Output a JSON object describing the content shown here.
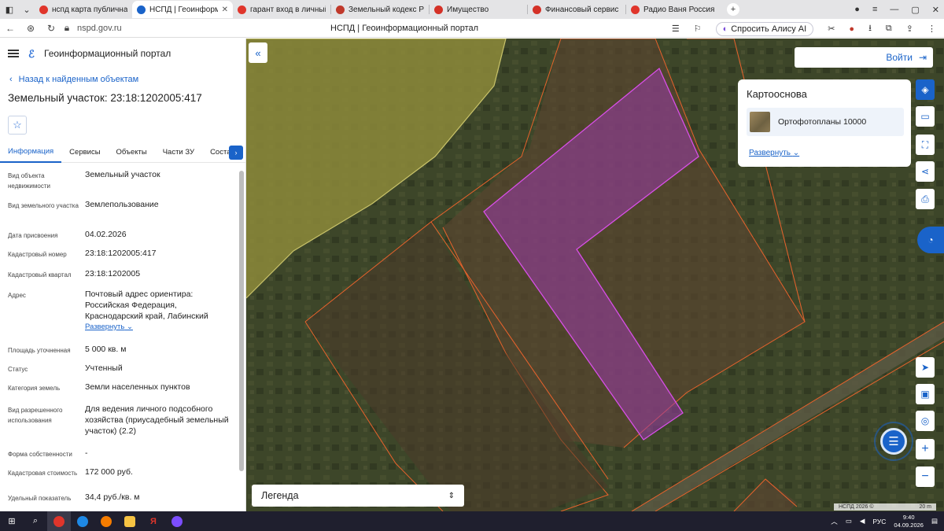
{
  "browser": {
    "tabs": [
      {
        "title": "нспд карта публичная ка",
        "color": "#e0352b"
      },
      {
        "title": "НСПД | Геоинформацио",
        "color": "#1a63c9",
        "active": true
      },
      {
        "title": "гарант вход в личный ка",
        "color": "#e0352b"
      },
      {
        "title": "Земельный кодекс Росси",
        "color": "#c0392b"
      },
      {
        "title": "Имущество",
        "color": "#d43127"
      },
      {
        "title": "Финансовый сервис",
        "color": "#d43127"
      },
      {
        "title": "Радио Ваня Россия",
        "color": "#e0352b"
      }
    ],
    "url": "nspd.gov.ru",
    "page_title": "НСПД | Геоинформационный портал",
    "alisa_label": "Спросить Алису AI"
  },
  "panel": {
    "portal_title": "Геоинформационный портал",
    "back_label": "Назад к найденным объектам",
    "object_title": "Земельный участок: 23:18:1202005:417",
    "tabs": [
      "Информация",
      "Сервисы",
      "Объекты",
      "Части ЗУ",
      "Состав"
    ],
    "rows": [
      {
        "k": "Вид объекта недвижимости",
        "v": "Земельный участок"
      },
      {
        "k": "Вид земельного участка",
        "v": "Землепользование"
      },
      {
        "k": "Дата присвоения",
        "v": "04.02.2026"
      },
      {
        "k": "Кадастровый номер",
        "v": "23:18:1202005:417"
      },
      {
        "k": "Кадастровый квартал",
        "v": "23:18:1202005"
      },
      {
        "k": "Адрес",
        "v": "Почтовый адрес ориентира: Российская Федерация, Краснодарский край, Лабинский",
        "more": "Развернуть"
      },
      {
        "k": "Площадь уточненная",
        "v": "5 000 кв. м"
      },
      {
        "k": "Статус",
        "v": "Учтенный"
      },
      {
        "k": "Категория земель",
        "v": "Земли населенных пунктов"
      },
      {
        "k": "Вид разрешенного использования",
        "v": "Для ведения личного подсобного хозяйства (приусадебный земельный участок) (2.2)"
      },
      {
        "k": "Форма собственности",
        "v": "-"
      },
      {
        "k": "Кадастровая стоимость",
        "v": "172 000 руб."
      },
      {
        "k": "Удельный показатель",
        "v": "34,4 руб./кв. м"
      }
    ]
  },
  "map": {
    "login_label": "Войти",
    "basemap_title": "Картооснова",
    "basemap_item": "Ортофотопланы 10000",
    "basemap_expand": "Развернуть",
    "legend_label": "Легенда",
    "attribution": "НСПД 2026 ©",
    "scale_label": "20 m"
  },
  "taskbar": {
    "lang": "РУС",
    "time": "9:40",
    "date": "04.09.2026"
  },
  "colors": {
    "accent": "#1a63c9",
    "parcel_highlight": "#c23bd4",
    "parcel_border": "#e8622c"
  }
}
